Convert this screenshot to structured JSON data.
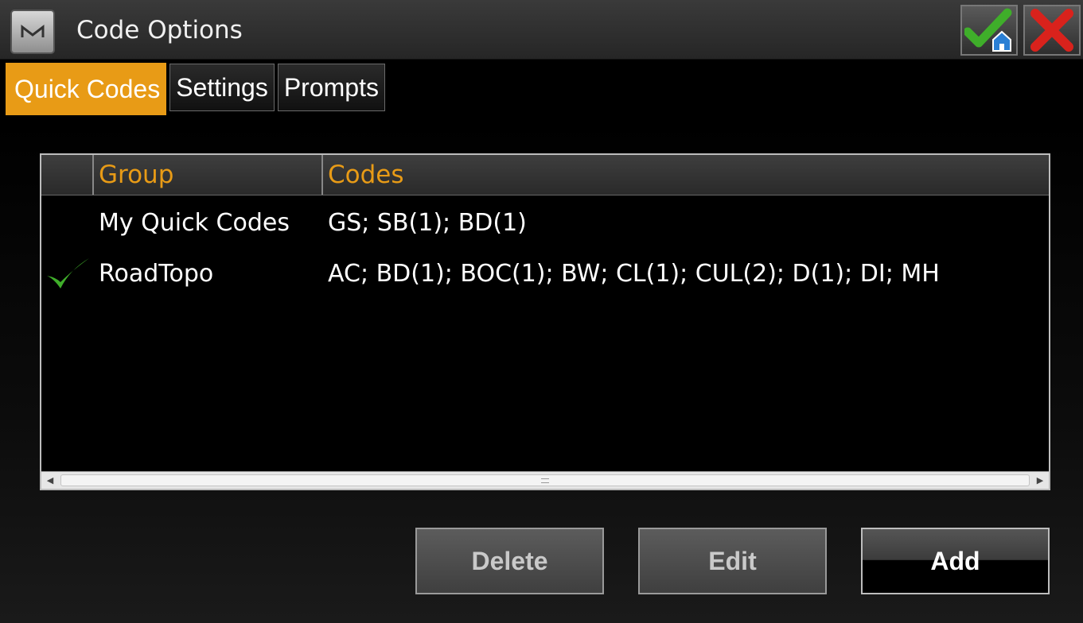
{
  "window": {
    "title": "Code Options",
    "app_icon_letter": "M"
  },
  "tabs": [
    {
      "label": "Quick Codes",
      "active": true
    },
    {
      "label": "Settings",
      "active": false
    },
    {
      "label": "Prompts",
      "active": false
    }
  ],
  "table": {
    "columns": [
      "",
      "Group",
      "Codes"
    ],
    "rows": [
      {
        "checked": false,
        "group": "My Quick Codes",
        "codes": "GS; SB(1); BD(1)"
      },
      {
        "checked": true,
        "group": "RoadTopo",
        "codes": "AC; BD(1); BOC(1); BW; CL(1); CUL(2); D(1); DI; MH"
      }
    ]
  },
  "buttons": {
    "delete": "Delete",
    "edit": "Edit",
    "add": "Add"
  },
  "colors": {
    "accent": "#e89b16",
    "check_green": "#3fae2a",
    "close_red": "#d9221c"
  }
}
